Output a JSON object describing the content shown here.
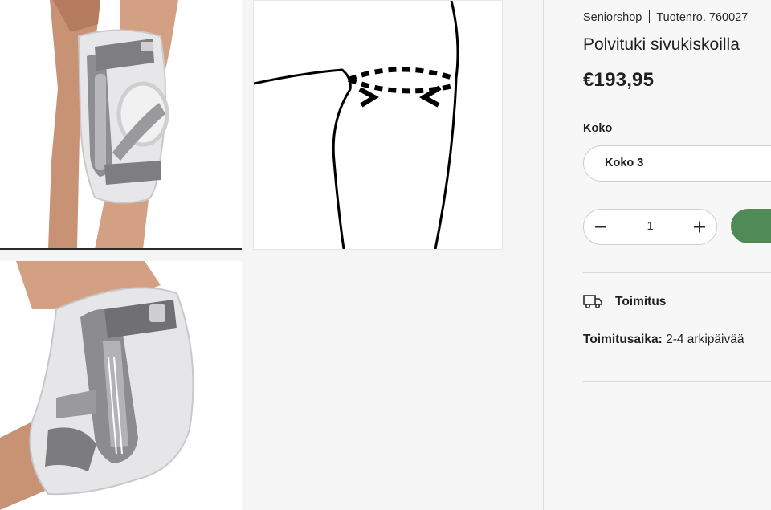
{
  "product": {
    "brand": "Seniorshop",
    "sku_label": "Tuotenro. 760027",
    "title": "Polvituki sivukiskoilla",
    "price": "€193,95"
  },
  "gallery": {
    "images": [
      {
        "name": "knee-brace-front",
        "selected": true
      },
      {
        "name": "knee-measurement-diagram",
        "selected": false
      },
      {
        "name": "knee-brace-side-bent",
        "selected": false
      }
    ]
  },
  "size": {
    "label": "Koko",
    "selected": "Koko 3"
  },
  "quantity": {
    "value": "1"
  },
  "delivery": {
    "title": "Toimitus",
    "time_label": "Toimitusaika:",
    "time_value": "2-4 arkipäivää"
  },
  "colors": {
    "accent_green": "#4f8a57",
    "border": "#cfcfcf",
    "panel_bg": "#f7f7f7"
  },
  "icons": {
    "quantity_decrease": "minus-icon",
    "quantity_increase": "plus-icon",
    "delivery": "truck-icon"
  }
}
